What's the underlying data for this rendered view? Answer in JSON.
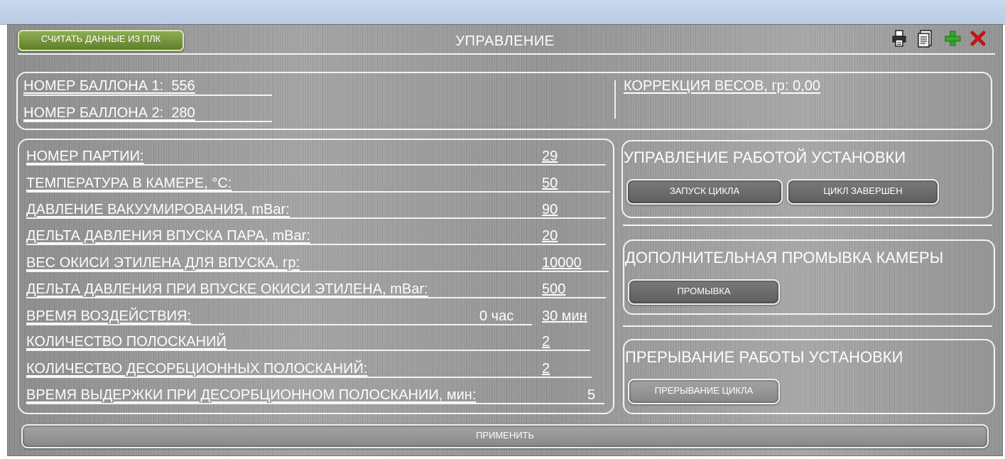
{
  "header": {
    "read_button_label": "СЧИТАТЬ ДАННЫЕ ИЗ ПЛК",
    "title": "УПРАВЛЕНИЕ",
    "icons": [
      "print-icon",
      "document-icon",
      "add-icon",
      "close-icon"
    ]
  },
  "cylinders": {
    "cylinder1_label": "НОМЕР БАЛЛОНА 1:",
    "cylinder1_value": "556",
    "cylinder2_label": "НОМЕР БАЛЛОНА 2:",
    "cylinder2_value": "280",
    "weight_correction_label": "КОРРЕКЦИЯ ВЕСОВ, гр:",
    "weight_correction_value": "0,00"
  },
  "params": [
    {
      "label": "НОМЕР ПАРТИИ:",
      "value": "29"
    },
    {
      "label": "ТЕМПЕРАТУРА В КАМЕРЕ, °С:",
      "value": "50"
    },
    {
      "label": "ДАВЛЕНИЕ ВАКУУМИРОВАНИЯ, mBar:",
      "value": "90"
    },
    {
      "label": "ДЕЛЬТА ДАВЛЕНИЯ ВПУСКА ПАРА, mBar:",
      "value": "20"
    },
    {
      "label": "ВЕС ОКИСИ ЭТИЛЕНА ДЛЯ ВПУСКА, гр:",
      "value": "10000"
    },
    {
      "label": "ДЕЛЬТА ДАВЛЕНИЯ ПРИ ВПУСКЕ ОКИСИ ЭТИЛЕНА, mBar:",
      "value": "500"
    },
    {
      "label": "ВРЕМЯ ВОЗДЕЙСТВИЯ:",
      "hours": "0 час",
      "minutes": "30 мин"
    },
    {
      "label": "КОЛИЧЕСТВО ПОЛОСКАНИЙ",
      "value": "2"
    },
    {
      "label": "КОЛИЧЕСТВО ДЕСОРБЦИОННЫХ ПОЛОСКАНИЙ:",
      "value": "2"
    },
    {
      "label": "ВРЕМЯ ВЫДЕРЖКИ ПРИ ДЕСОРБЦИОННОМ ПОЛОСКАНИИ, мин:",
      "value": "5"
    }
  ],
  "control": {
    "title": "УПРАВЛЕНИЕ РАБОТОЙ УСТАНОВКИ",
    "start_label": "ЗАПУСК ЦИКЛА",
    "done_label": "ЦИКЛ ЗАВЕРШЕН"
  },
  "flush": {
    "title": "ДОПОЛНИТЕЛЬНАЯ ПРОМЫВКА КАМЕРЫ",
    "button_label": "ПРОМЫВКА"
  },
  "interrupt": {
    "title": "ПРЕРЫВАНИЕ РАБОТЫ УСТАНОВКИ",
    "button_label": "ПРЕРЫВАНИЕ ЦИКЛА"
  },
  "apply_label": "ПРИМЕНИТЬ"
}
